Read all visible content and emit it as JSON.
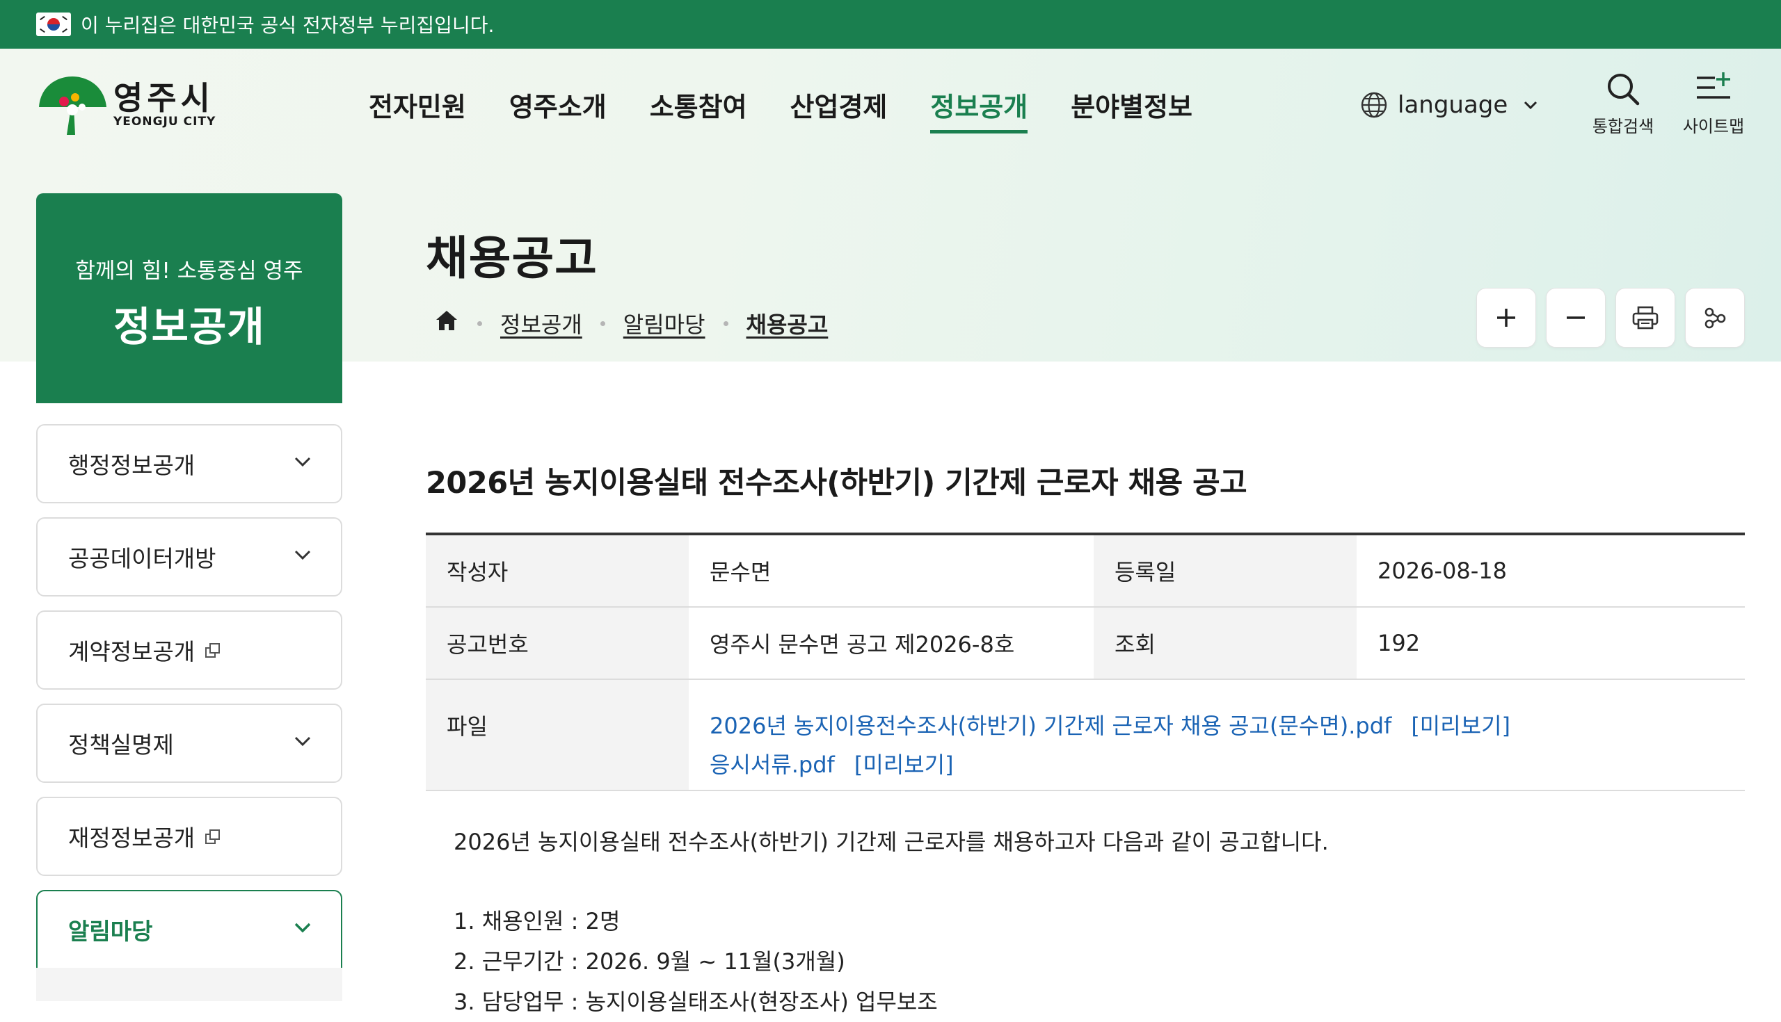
{
  "gov_banner": {
    "text": "이 누리집은 대한민국 공식 전자정부 누리집입니다."
  },
  "logo": {
    "name_ko": "영주시",
    "name_en": "YEONGJU CITY"
  },
  "gnb": [
    {
      "label": "전자민원",
      "active": false
    },
    {
      "label": "영주소개",
      "active": false
    },
    {
      "label": "소통참여",
      "active": false
    },
    {
      "label": "산업경제",
      "active": false
    },
    {
      "label": "정보공개",
      "active": true
    },
    {
      "label": "분야별정보",
      "active": false
    }
  ],
  "header_utils": {
    "language": "language",
    "search": "통합검색",
    "sitemap": "사이트맵"
  },
  "side": {
    "subtitle": "함께의 힘! 소통중심 영주",
    "title": "정보공개",
    "items": [
      {
        "label": "행정정보공개",
        "icon": "chevron-down-icon"
      },
      {
        "label": "공공데이터개방",
        "icon": "chevron-down-icon"
      },
      {
        "label": "계약정보공개",
        "icon": "external-link-icon"
      },
      {
        "label": "정책실명제",
        "icon": "chevron-down-icon"
      },
      {
        "label": "재정정보공개",
        "icon": "external-link-icon"
      },
      {
        "label": "알림마당",
        "icon": "chevron-down-icon",
        "active": true
      }
    ]
  },
  "page": {
    "title": "채용공고",
    "breadcrumb": [
      "정보공개",
      "알림마당",
      "채용공고"
    ]
  },
  "tools": [
    "zoom-in-icon",
    "zoom-out-icon",
    "print-icon",
    "share-icon"
  ],
  "post": {
    "title": "2026년 농지이용실태 전수조사(하반기) 기간제 근로자 채용 공고",
    "author_label": "작성자",
    "author": "문수면",
    "date_label": "등록일",
    "date": "2026-08-18",
    "notice_label": "공고번호",
    "notice_no": "영주시 문수면 공고 제2026-8호",
    "views_label": "조회",
    "views": "192",
    "file_label": "파일",
    "files": [
      {
        "name": "2026년 농지이용전수조사(하반기) 기간제 근로자 채용 공고(문수면).pdf",
        "preview": "[미리보기]"
      },
      {
        "name": "응시서류.pdf",
        "preview": "[미리보기]"
      }
    ],
    "intro": "2026년 농지이용실태 전수조사(하반기) 기간제 근로자를 채용하고자 다음과 같이 공고합니다.",
    "items": [
      "1. 채용인원 : 2명",
      "2. 근무기간 : 2026. 9월 ~ 11월(3개월)",
      "3. 담당업무 : 농지이용실태조사(현장조사) 업무보조"
    ]
  },
  "colors": {
    "brand_green": "#1a7f4f",
    "link_blue": "#1a63b4"
  }
}
